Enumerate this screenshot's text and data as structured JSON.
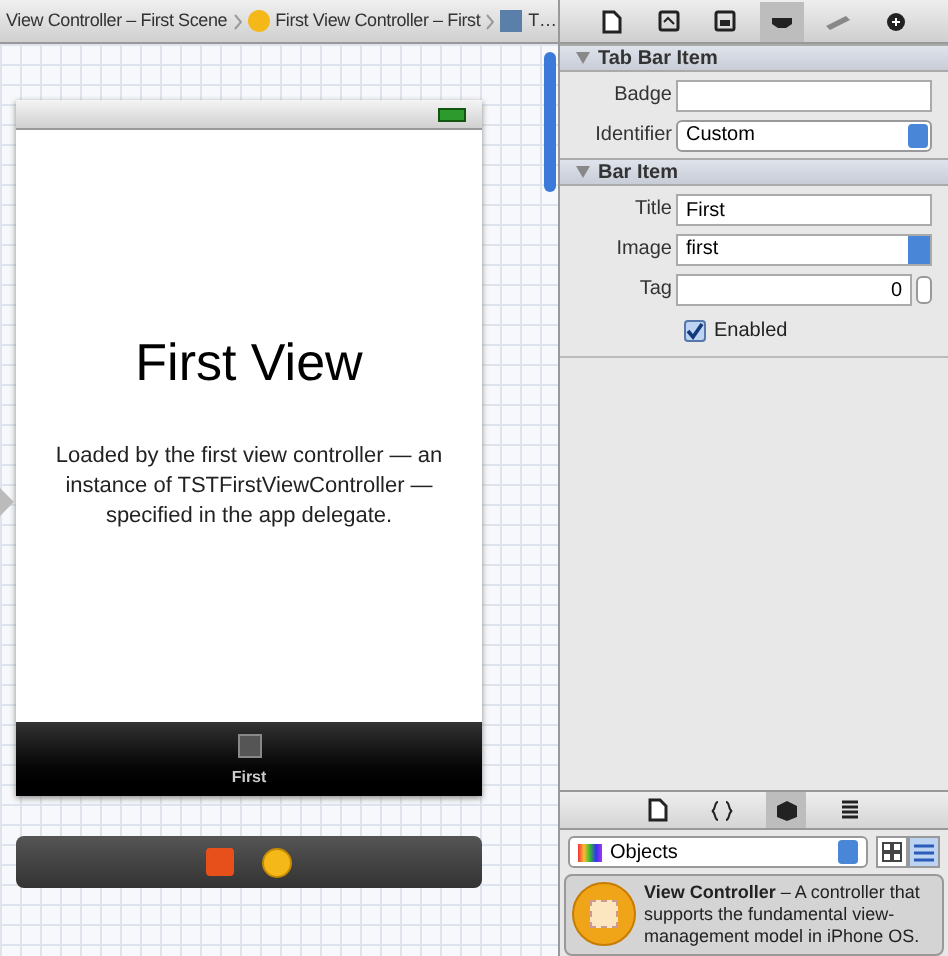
{
  "breadcrumb": [
    {
      "label": "View Controller – First Scene",
      "kind": "text"
    },
    {
      "label": "First View Controller – First",
      "kind": "controller"
    },
    {
      "label": "T…",
      "kind": "tabbar"
    }
  ],
  "inspector_tabs": [
    {
      "kind": "file",
      "selected": false
    },
    {
      "kind": "help",
      "selected": false
    },
    {
      "kind": "identity",
      "selected": false
    },
    {
      "kind": "attributes",
      "selected": true
    },
    {
      "kind": "size",
      "selected": false
    },
    {
      "kind": "connections",
      "selected": false
    }
  ],
  "tab_bar_item": {
    "title": "Tab Bar Item",
    "expanded": true,
    "badge": {
      "label": "Badge"
    },
    "identifier": {
      "label": "Identifier",
      "value": "Custom"
    }
  },
  "bar_item": {
    "title": "Bar Item",
    "expanded": true,
    "title_field": {
      "label": "Title",
      "value": "First"
    },
    "image": {
      "label": "Image",
      "value": "first"
    },
    "tag": {
      "label": "Tag",
      "value": "0"
    },
    "enabled": {
      "label": "Enabled",
      "checked": true
    }
  },
  "scene": {
    "heading": "First View",
    "body": "Loaded by the first view controller — an instance of TSTFirstViewController — specified in the app delegate.",
    "tab_item": "First"
  },
  "library_tabs": [
    {
      "kind": "file",
      "selected": false
    },
    {
      "kind": "code",
      "selected": false
    },
    {
      "kind": "objects",
      "selected": true
    },
    {
      "kind": "media",
      "selected": false
    }
  ],
  "library": {
    "category": "Objects",
    "view_modes": [
      {
        "kind": "grid",
        "selected": false
      },
      {
        "kind": "list",
        "selected": true
      }
    ],
    "items": [
      {
        "name": "View Controller",
        "description": " – A controller that supports the fundamental view-management model in iPhone OS.",
        "selected": true
      }
    ]
  }
}
